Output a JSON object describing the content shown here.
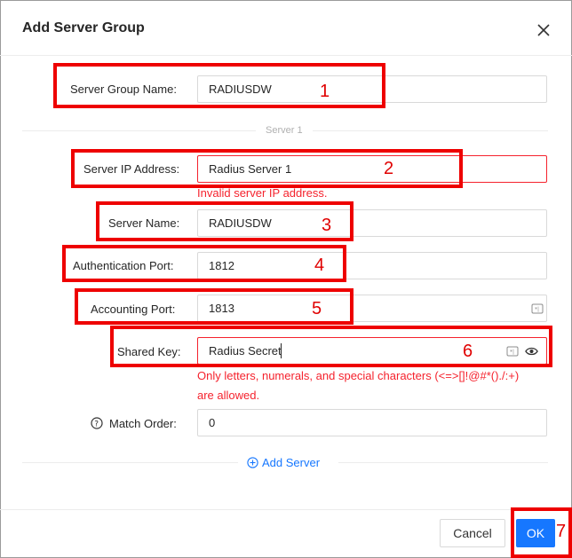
{
  "dialog": {
    "title": "Add Server Group",
    "close_icon": "close-icon"
  },
  "form": {
    "group_name": {
      "label": "Server Group Name:",
      "value": "RADIUSDW"
    },
    "section_title": "Server 1",
    "server_ip": {
      "label": "Server IP Address:",
      "value": "Radius Server 1",
      "error": "Invalid server IP address."
    },
    "server_name": {
      "label": "Server Name:",
      "value": "RADIUSDW"
    },
    "auth_port": {
      "label": "Authentication Port:",
      "value": "1812"
    },
    "acct_port": {
      "label": "Accounting Port:",
      "value": "1813",
      "icon": "keyboard-icon"
    },
    "shared_key": {
      "label": "Shared Key:",
      "value": "Radius Secret",
      "icons": [
        "keyboard-icon",
        "eye-icon"
      ],
      "error_line1": "Only letters, numerals, and special characters (<=>[]!@#*()./:+)",
      "error_line2": "are allowed."
    },
    "match_order": {
      "label": "Match Order:",
      "value": "0",
      "help_icon": "question-circle-icon"
    },
    "add_server_label": "Add Server"
  },
  "footer": {
    "cancel_label": "Cancel",
    "ok_label": "OK"
  },
  "annotations": [
    "1",
    "2",
    "3",
    "4",
    "5",
    "6",
    "7"
  ],
  "colors": {
    "accent": "#1677ff",
    "error": "#f5222d",
    "highlight": "#ee0000"
  }
}
